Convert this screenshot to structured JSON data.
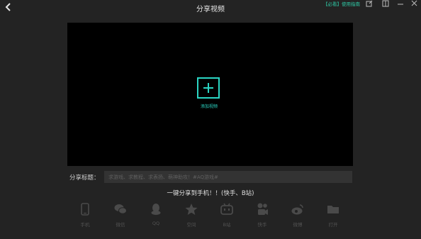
{
  "header": {
    "title": "分享视频",
    "guide_link": "【必看】使用指南"
  },
  "preview": {
    "add_label": "添加视频"
  },
  "share_title": {
    "label": "分享标题：",
    "placeholder": "求游戏、求教程、求表扬、萌神助攻！#AQ游戏#"
  },
  "oneclick_text": "一键分享到手机！！(快手、B站)",
  "targets": [
    {
      "label": "手机",
      "icon": "phone-icon"
    },
    {
      "label": "微信",
      "icon": "wechat-icon"
    },
    {
      "label": "QQ",
      "icon": "qq-icon"
    },
    {
      "label": "空间",
      "icon": "qzone-icon"
    },
    {
      "label": "B站",
      "icon": "bilibili-icon"
    },
    {
      "label": "快手",
      "icon": "kuaishou-icon"
    },
    {
      "label": "微博",
      "icon": "weibo-icon"
    },
    {
      "label": "打开",
      "icon": "folder-icon"
    }
  ],
  "colors": {
    "background": "#232323",
    "accent": "#2bd6c4",
    "guide_link": "#2ec9a6",
    "icon_gray": "#4a4a4a"
  }
}
